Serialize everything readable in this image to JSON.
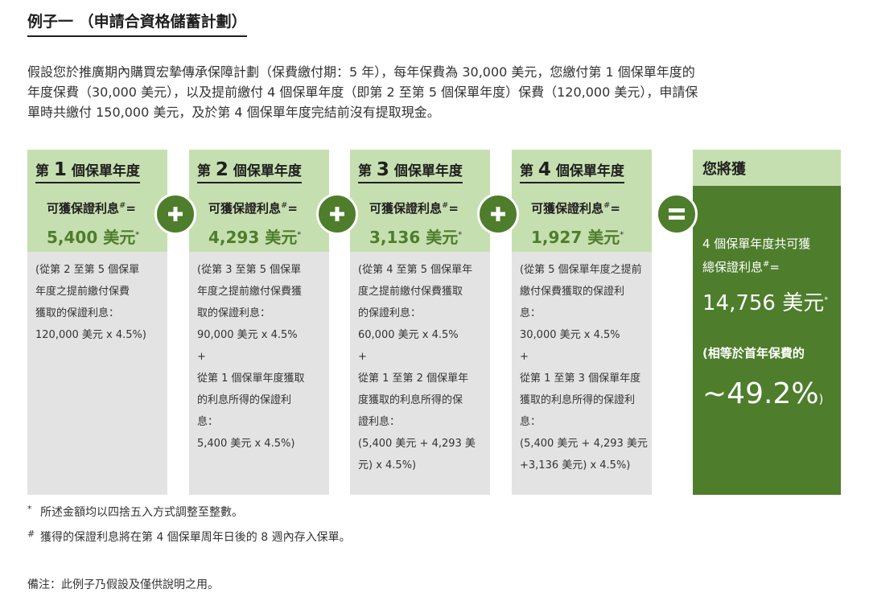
{
  "title": "例子一 （申請合資格儲蓄計劃）",
  "intro_lines": [
    "假設您於推廣期內購買宏摯傳承保障計劃（保費繳付期：5 年），每年保費為 30,000 美元，您繳付第 1 個保單年度的",
    "年度保費（30,000 美元），以及提前繳付 4 個保單年度（即第 2 至第 5 個保單年度）保費（120,000 美元），申請保",
    "單時共繳付 150,000 美元，及於第 4 個保單年度完結前沒有提取現金。"
  ],
  "cards": [
    {
      "year_pre": "第",
      "year_num": "1",
      "year_post": "個保單年度",
      "label": "可獲保證利息",
      "label_sup": "#",
      "label_eq": "=",
      "amount": "5,400 美元",
      "amount_sup": "*",
      "body": [
        "(從第 2 至第 5 個保單",
        "年度之提前繳付保費",
        "獲取的保證利息：",
        "120,000 美元 x 4.5%)"
      ]
    },
    {
      "year_pre": "第",
      "year_num": "2",
      "year_post": "個保單年度",
      "label": "可獲保證利息",
      "label_sup": "#",
      "label_eq": "=",
      "amount": "4,293 美元",
      "amount_sup": "*",
      "body": [
        "(從第 3 至第 5 個保單",
        "年度之提前繳付保費獲",
        "取的保證利息：",
        "90,000 美元 x 4.5%",
        "+",
        "從第 1 個保單年度獲取",
        "的利息所得的保證利",
        "息：",
        "5,400 美元 x 4.5%)"
      ]
    },
    {
      "year_pre": "第",
      "year_num": "3",
      "year_post": "個保單年度",
      "label": "可獲保證利息",
      "label_sup": "#",
      "label_eq": "=",
      "amount": "3,136 美元",
      "amount_sup": "*",
      "body": [
        "(從第 4 至第 5 個保單年",
        "度之提前繳付保費獲取",
        "的保證利息：",
        "60,000 美元 x 4.5%",
        "+",
        "從第 1 至第 2 個保單年",
        "度獲取的利息所得的保",
        "證利息：",
        "(5,400 美元 + 4,293 美",
        "元) x 4.5%)"
      ]
    },
    {
      "year_pre": "第",
      "year_num": "4",
      "year_post": "個保單年度",
      "label": "可獲保證利息",
      "label_sup": "#",
      "label_eq": "=",
      "amount": "1,927 美元",
      "amount_sup": "*",
      "body": [
        "(從第 5 個保單年度之提前",
        "繳付保費獲取的保證利",
        "息：",
        "30,000 美元 x 4.5%",
        "+",
        "從第 1 至第 3 個保單年度",
        "獲取的利息所得的保證利",
        "息：",
        "(5,400 美元 + 4,293 美元",
        "+3,136 美元) x 4.5%)"
      ]
    }
  ],
  "operators": [
    {
      "symbol": "plus",
      "icon": "plus-icon"
    },
    {
      "symbol": "plus",
      "icon": "plus-icon"
    },
    {
      "symbol": "plus",
      "icon": "plus-icon"
    },
    {
      "symbol": "equals",
      "icon": "equals-icon"
    }
  ],
  "result": {
    "title": "您將獲",
    "line1": "4 個保單年度共可獲",
    "line2": "總保證利息",
    "line2_sup": "#",
    "line2_eq": "=",
    "total": "14,756 美元",
    "total_sup": "*",
    "note": "(相等於首年保費的",
    "percent": "~49.2%",
    "percent_close": ")"
  },
  "footnotes": [
    {
      "mark": "*",
      "text": "所述金額均以四捨五入方式調整至整數。"
    },
    {
      "mark": "#",
      "text": "獲得的保證利息將在第 4 個保單周年日後的 8 週內存入保單。"
    }
  ],
  "remark": "備注：此例子乃假設及僅供說明之用。",
  "colors": {
    "dark_green": "#4e7d2c",
    "light_green": "#c6dfb0",
    "gray": "#e3e3e3"
  }
}
